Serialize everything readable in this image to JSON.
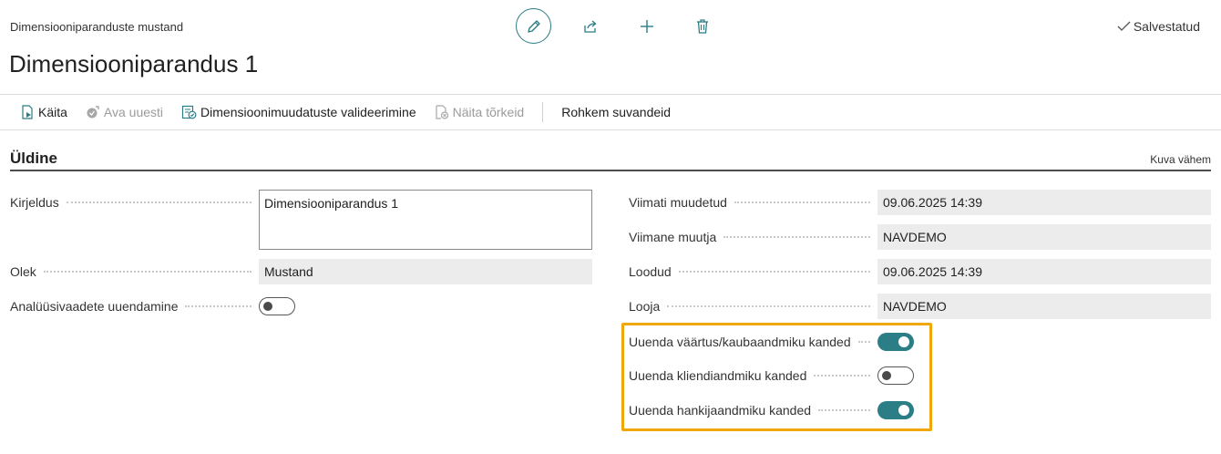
{
  "header": {
    "breadcrumb": "Dimensiooniparanduste mustand",
    "title": "Dimensiooniparandus 1",
    "saved_label": "Salvestatud",
    "icons": [
      "edit-icon",
      "share-icon",
      "add-icon",
      "delete-icon"
    ]
  },
  "actions": [
    {
      "label": "Käita",
      "icon": "run-icon",
      "enabled": true
    },
    {
      "label": "Ava uuesti",
      "icon": "reopen-icon",
      "enabled": false
    },
    {
      "label": "Dimensioonimuudatuste valideerimine",
      "icon": "validate-icon",
      "enabled": true
    },
    {
      "label": "Näita tõrkeid",
      "icon": "errors-icon",
      "enabled": false
    },
    {
      "label": "Rohkem suvandeid",
      "enabled": true
    }
  ],
  "section": {
    "title": "Üldine",
    "toggle_label": "Kuva vähem"
  },
  "left_fields": {
    "description": {
      "label": "Kirjeldus",
      "value": "Dimensiooniparandus 1"
    },
    "status": {
      "label": "Olek",
      "value": "Mustand"
    },
    "update_analysis": {
      "label": "Analüüsivaadete uuendamine",
      "value": false
    }
  },
  "right_fields": {
    "last_modified": {
      "label": "Viimati muudetud",
      "value": "09.06.2025 14:39"
    },
    "last_modified_by": {
      "label": "Viimane muutja",
      "value": "NAVDEMO"
    },
    "created": {
      "label": "Loodud",
      "value": "09.06.2025 14:39"
    },
    "created_by": {
      "label": "Looja",
      "value": "NAVDEMO"
    },
    "update_value_entries": {
      "label": "Uuenda väärtus/kaubaandmiku kanded",
      "value": true
    },
    "update_customer_entries": {
      "label": "Uuenda kliendiandmiku kanded",
      "value": false
    },
    "update_vendor_entries": {
      "label": "Uuenda hankijaandmiku kanded",
      "value": true
    }
  },
  "colors": {
    "accent": "#2b7d86",
    "highlight": "#f0a70a"
  }
}
